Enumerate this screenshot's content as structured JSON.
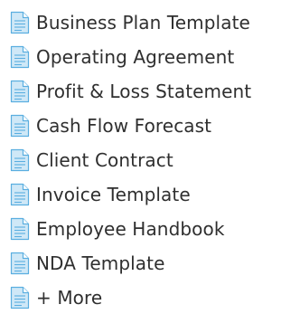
{
  "documents": {
    "items": [
      {
        "label": "Business Plan Template",
        "icon": "document-icon"
      },
      {
        "label": "Operating Agreement",
        "icon": "document-icon"
      },
      {
        "label": "Profit & Loss Statement",
        "icon": "document-icon"
      },
      {
        "label": "Cash Flow Forecast",
        "icon": "document-icon"
      },
      {
        "label": "Client Contract",
        "icon": "document-icon"
      },
      {
        "label": "Invoice Template",
        "icon": "document-icon"
      },
      {
        "label": "Employee Handbook",
        "icon": "document-icon"
      },
      {
        "label": "NDA Template",
        "icon": "document-icon"
      },
      {
        "label": "+ More",
        "icon": "document-icon"
      }
    ]
  },
  "colors": {
    "icon_fill": "#cfe8f7",
    "icon_stroke": "#5aaee0",
    "icon_lines": "#5aaee0",
    "text": "#2f2f2f"
  }
}
